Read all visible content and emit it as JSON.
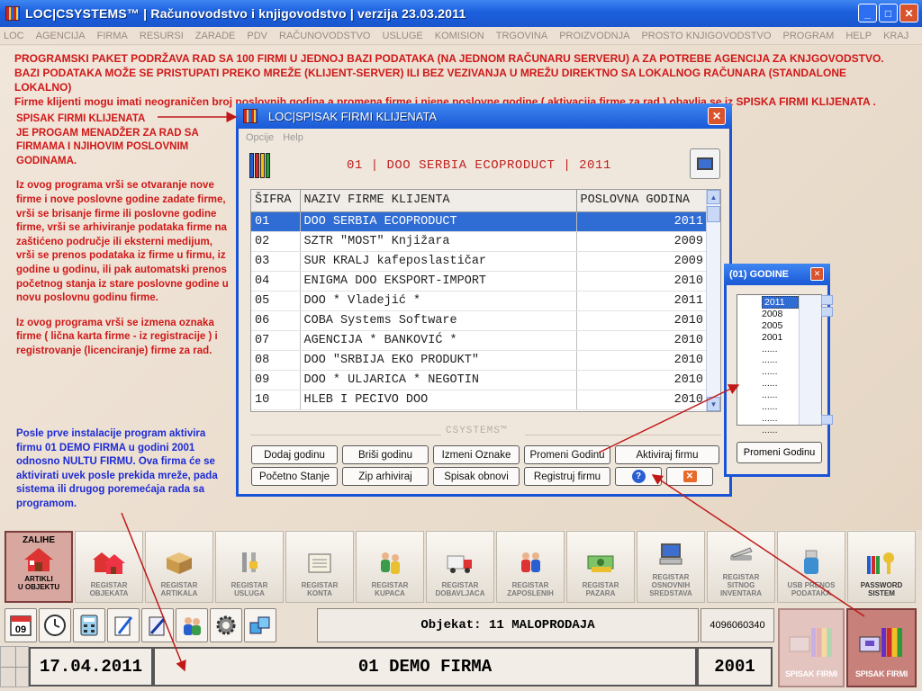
{
  "window": {
    "title": "LOC|CSYSTEMS™ | Računovodstvo i knjigovodstvo | verzija 23.03.2011",
    "minimize": "_",
    "maximize": "□",
    "close": "✕"
  },
  "menu": [
    "LOC",
    "AGENCIJA",
    "FIRMA",
    "RESURSI",
    "ZARADE",
    "PDV",
    "RAČUNOVODSTVO",
    "USLUGE",
    "KOMISION",
    "TRGOVINA",
    "PROIZVODNJA",
    "PROSTO KNJIGOVODSTVO",
    "PROGRAM",
    "HELP",
    "KRAJ"
  ],
  "info_top": [
    "PROGRAMSKI PAKET PODRŽAVA RAD SA 100 FIRMI U JEDNOJ BAZI PODATAKA (NA JEDNOM RAČUNARU SERVERU) A ZA POTREBE AGENCIJA ZA KNJGOVODSTVO.",
    "BAZI PODATAKA MOŽE SE PRISTUPATI PREKO MREŽE (KLIJENT-SERVER) ILI BEZ VEZIVANJA U MREŽU DIREKTNO SA LOKALNOG RAČUNARA (STANDALONE LOKALNO)",
    "Firme klijenti mogu imati neograničen broj poslovnih godina a promena firme i njene poslovne godine ( aktivacija firme za rad ) obavlja se iz SPISKA FIRMI KLIJENATA ."
  ],
  "left_text": [
    "SPISAK FIRMI KLIJENATA\nJE PROGAM MENADŽER ZA RAD SA FIRMAMA I NJIHOVIM POSLOVNIM GODINAMA.",
    "Iz ovog programa vrši se otvaranje nove firme i nove poslovne godine zadate firme, vrši se brisanje firme ili poslovne godine firme, vrši se arhiviranje podataka firme na zaštićeno područje ili eksterni medijum, vrši se prenos podataka iz firme u firmu, iz godine u godinu, ili pak automatski prenos početnog stanja iz stare poslovne godine u novu poslovnu godinu firme.",
    "Iz ovog programa vrši se izmena oznaka firme ( lična karta firme - iz registracije ) i registrovanje (licenciranje) firme za rad."
  ],
  "left_text_blue": "Posle prve instalacije program aktivira firmu 01 DEMO FIRMA u godini 2001 odnosno NULTU FIRMU. Ova firma će se aktivirati uvek posle prekida mreže, pada sistema ili drugog poremećaja rada sa programom.",
  "dialog": {
    "title": "LOC|SPISAK FIRMI KLIJENATA",
    "menu": [
      "Opcije",
      "Help"
    ],
    "active_firm": "01  |  DOO SERBIA ECOPRODUCT  | 2011",
    "columns": [
      "ŠIFRA",
      "NAZIV FIRME KLIJENTA",
      "POSLOVNA GODINA"
    ],
    "rows": [
      {
        "code": "01",
        "name": "DOO SERBIA ECOPRODUCT",
        "year": "2011"
      },
      {
        "code": "02",
        "name": "SZTR \"MOST\" Knjižara",
        "year": "2009"
      },
      {
        "code": "03",
        "name": "SUR KRALJ kafeposlastičar",
        "year": "2009"
      },
      {
        "code": "04",
        "name": "ENIGMA DOO EKSPORT-IMPORT",
        "year": "2010"
      },
      {
        "code": "05",
        "name": "DOO * Vladejić *",
        "year": "2011"
      },
      {
        "code": "06",
        "name": "COBA Systems Software",
        "year": "2010"
      },
      {
        "code": "07",
        "name": "AGENCIJA * BANKOVIĆ *",
        "year": "2010"
      },
      {
        "code": "08",
        "name": "DOO \"SRBIJA EKO PRODUKT\"",
        "year": "2010"
      },
      {
        "code": "09",
        "name": "DOO * ULJARICA * NEGOTIN",
        "year": "2010"
      },
      {
        "code": "10",
        "name": "HLEB I PECIVO DOO",
        "year": "2010"
      }
    ],
    "watermark": "CSYSTEMS™",
    "buttons_row1": [
      "Dodaj godinu",
      "Briši godinu",
      "Izmeni Oznake",
      "Promeni Godinu",
      "Aktiviraj firmu"
    ],
    "buttons_row2": [
      "Početno Stanje",
      "Zip arhiviraj",
      "Spisak obnovi",
      "Registruj firmu"
    ],
    "help_glyph": "?",
    "close_glyph": "✕"
  },
  "years_popup": {
    "title": "(01) GODINE",
    "close": "✕",
    "items": [
      "2011",
      "2008",
      "2005",
      "2001",
      "......",
      "......",
      "......",
      "......",
      "......",
      "......",
      "......",
      "......"
    ],
    "button": "Promeni Godinu"
  },
  "modules": [
    {
      "label": "ARTIKLI\nU OBJEKTU",
      "top": "ZALIHE",
      "icon": "house-icon"
    },
    {
      "label": "REGISTAR\nOBJEKATA",
      "icon": "houses-icon"
    },
    {
      "label": "REGISTAR\nARTIKALA",
      "icon": "box-icon"
    },
    {
      "label": "REGISTAR\nUSLUGA",
      "icon": "tools-icon"
    },
    {
      "label": "REGISTAR\nKONTA",
      "icon": "ledger-icon"
    },
    {
      "label": "REGISTAR\nKUPACA",
      "icon": "customers-icon"
    },
    {
      "label": "REGISTAR\nDOBAVLJACA",
      "icon": "truck-icon"
    },
    {
      "label": "REGISTAR\nZAPOSLENIH",
      "icon": "employees-icon"
    },
    {
      "label": "REGISTAR\nPAZARA",
      "icon": "money-icon"
    },
    {
      "label": "REGISTAR\nOSNOVNIH\nSREDSTAVA",
      "icon": "computer-icon"
    },
    {
      "label": "REGISTAR\nSITNOG\nINVENTARA",
      "icon": "stapler-icon"
    },
    {
      "label": "USB PRENOS\nPODATAKA",
      "icon": "usb-icon"
    },
    {
      "label": "PASSWORD\nSISTEM",
      "icon": "keys-icon",
      "dark": true
    }
  ],
  "calendar_day": "09",
  "objekat": "Objekat: 11  MALOPRODAJA",
  "code": "4096060340",
  "status": {
    "date": "17.04.2011",
    "firm": "01  DEMO FIRMA",
    "year": "2001"
  },
  "big_buttons": [
    {
      "label": "SPISAK FIRMI",
      "state": "disabled"
    },
    {
      "label": "SPISAK FIRMI",
      "state": "active"
    }
  ],
  "colors": {
    "red_text": "#d01818",
    "blue_text": "#1d2bd6",
    "title_blue": "#1954d6",
    "selection": "#2f6cd4"
  }
}
